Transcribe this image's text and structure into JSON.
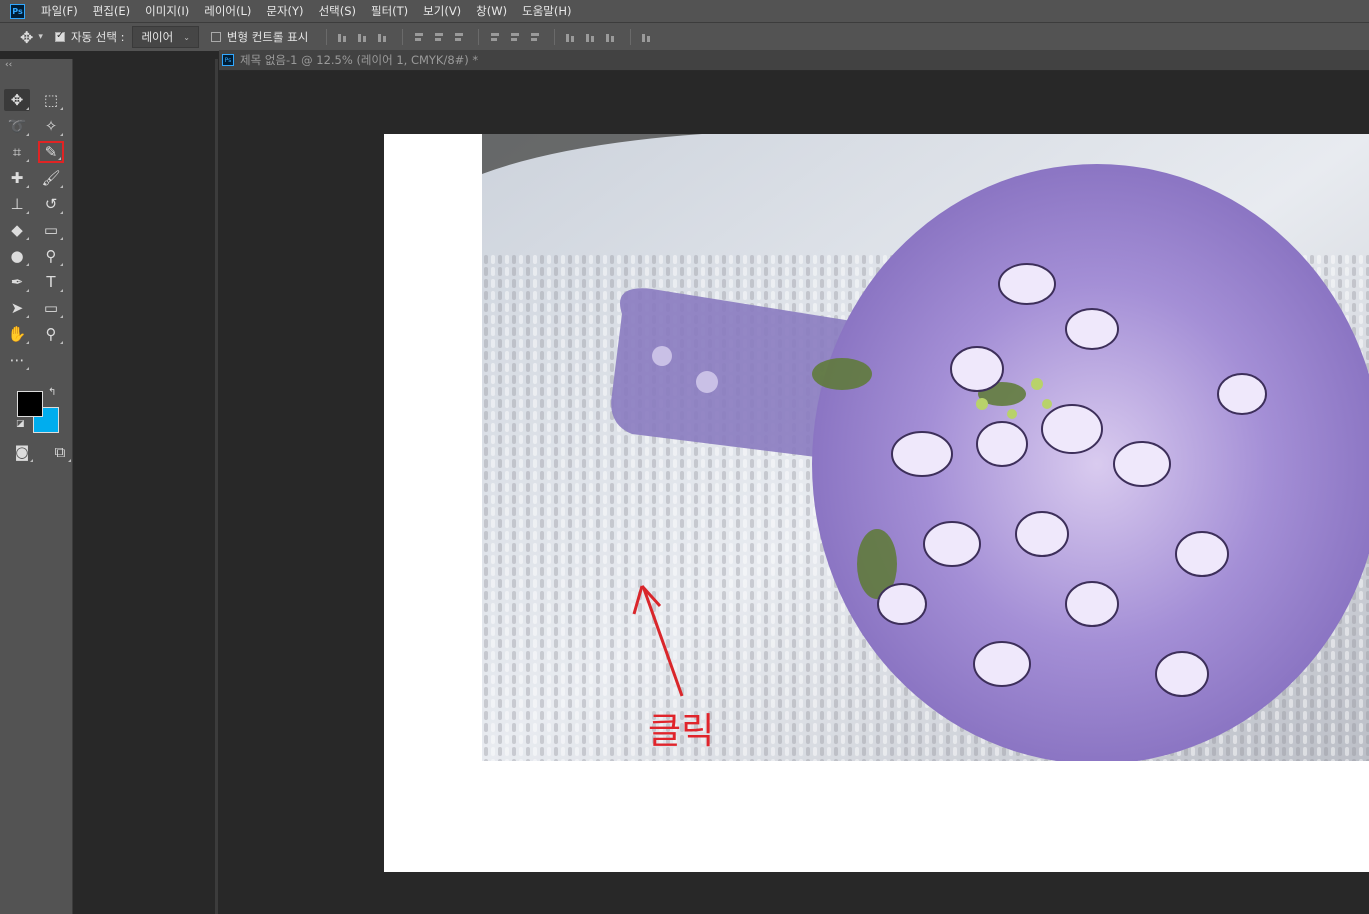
{
  "menu": {
    "logo": "Ps",
    "items": [
      "파일(F)",
      "편집(E)",
      "이미지(I)",
      "레이어(L)",
      "문자(Y)",
      "선택(S)",
      "필터(T)",
      "보기(V)",
      "창(W)",
      "도움말(H)"
    ]
  },
  "options": {
    "auto_select_label": "자동 선택 :",
    "auto_select_value": "레이어",
    "transform_controls_label": "변형 컨트롤 표시"
  },
  "document": {
    "tab_title": "제목 없음-1 @ 12.5% (레이어 1, CMYK/8#) *"
  },
  "annotation": {
    "text": "클릭"
  },
  "colors": {
    "foreground": "#000000",
    "background": "#00adee",
    "highlight": "#e02424"
  },
  "tools": [
    "move-tool",
    "marquee-tool",
    "lasso-tool",
    "magic-wand-tool",
    "crop-tool",
    "eyedropper-tool",
    "healing-brush-tool",
    "brush-tool",
    "clone-stamp-tool",
    "history-brush-tool",
    "eraser-tool",
    "gradient-tool",
    "blur-tool",
    "dodge-tool",
    "pen-tool",
    "type-tool",
    "path-selection-tool",
    "rectangle-tool",
    "hand-tool",
    "zoom-tool"
  ]
}
